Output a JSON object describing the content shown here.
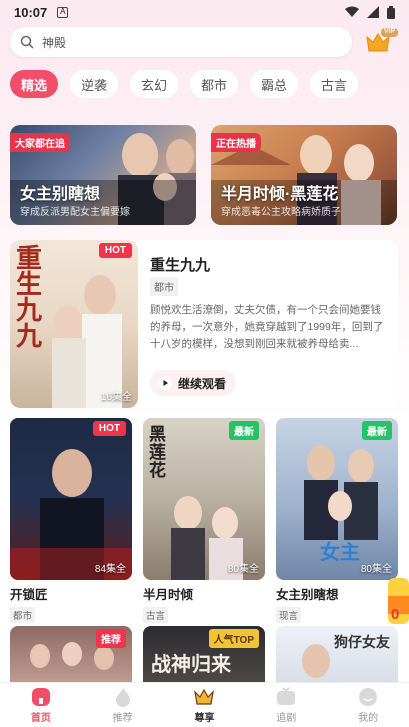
{
  "status": {
    "time": "10:07",
    "sim": "A"
  },
  "search": {
    "placeholder": "神殿"
  },
  "vip_badge": "VIP",
  "categories": [
    {
      "label": "精选",
      "active": true
    },
    {
      "label": "逆袭"
    },
    {
      "label": "玄幻"
    },
    {
      "label": "都市"
    },
    {
      "label": "霸总"
    },
    {
      "label": "古言"
    }
  ],
  "banners": [
    {
      "tag": "大家都在追",
      "title": "女主别瞎想",
      "subtitle": "穿成反派男配女主偏要嫁"
    },
    {
      "tag": "正在热播",
      "title": "半月时倾·黑莲花",
      "subtitle": "穿成恶毒公主攻略病娇质子"
    }
  ],
  "feature": {
    "badge": "HOT",
    "poster_text": "重生九九",
    "episodes": "16集全",
    "title": "重生九九",
    "genre": "都市",
    "description": "顾悦欢生活潦倒，丈夫欠债，有一个只会间她要钱的养母，一次意外，她竟穿越到了1999年，回到了十八岁的模样，没想到刚回来就被养母给卖...",
    "continue_label": "继续观看"
  },
  "cards": [
    {
      "badge": "HOT",
      "episodes": "84集全",
      "title": "开锁匠",
      "genre": "都市"
    },
    {
      "badge": "最新",
      "poster_text": "黑莲花",
      "episodes": "80集全",
      "title": "半月时倾",
      "genre": "古言"
    },
    {
      "badge": "最新",
      "poster_text": "女主",
      "episodes": "80集全",
      "title": "女主别瞎想",
      "genre": "现言"
    }
  ],
  "more_cards": [
    {
      "badge": "推荐"
    },
    {
      "badge": "人气TOP",
      "poster_text": "战神归来"
    },
    {
      "poster_text": "狗仔女友"
    }
  ],
  "float_text": "0",
  "nav": [
    {
      "label": "首页",
      "icon": "home-icon",
      "active": true
    },
    {
      "label": "推荐",
      "icon": "fire-icon"
    },
    {
      "label": "尊享",
      "icon": "crown-icon"
    },
    {
      "label": "追剧",
      "icon": "tv-icon"
    },
    {
      "label": "我的",
      "icon": "user-icon"
    }
  ],
  "colors": {
    "accent": "#f24e6a",
    "hot": "#f0344d",
    "new": "#26c268",
    "top": "#f2c23a"
  }
}
